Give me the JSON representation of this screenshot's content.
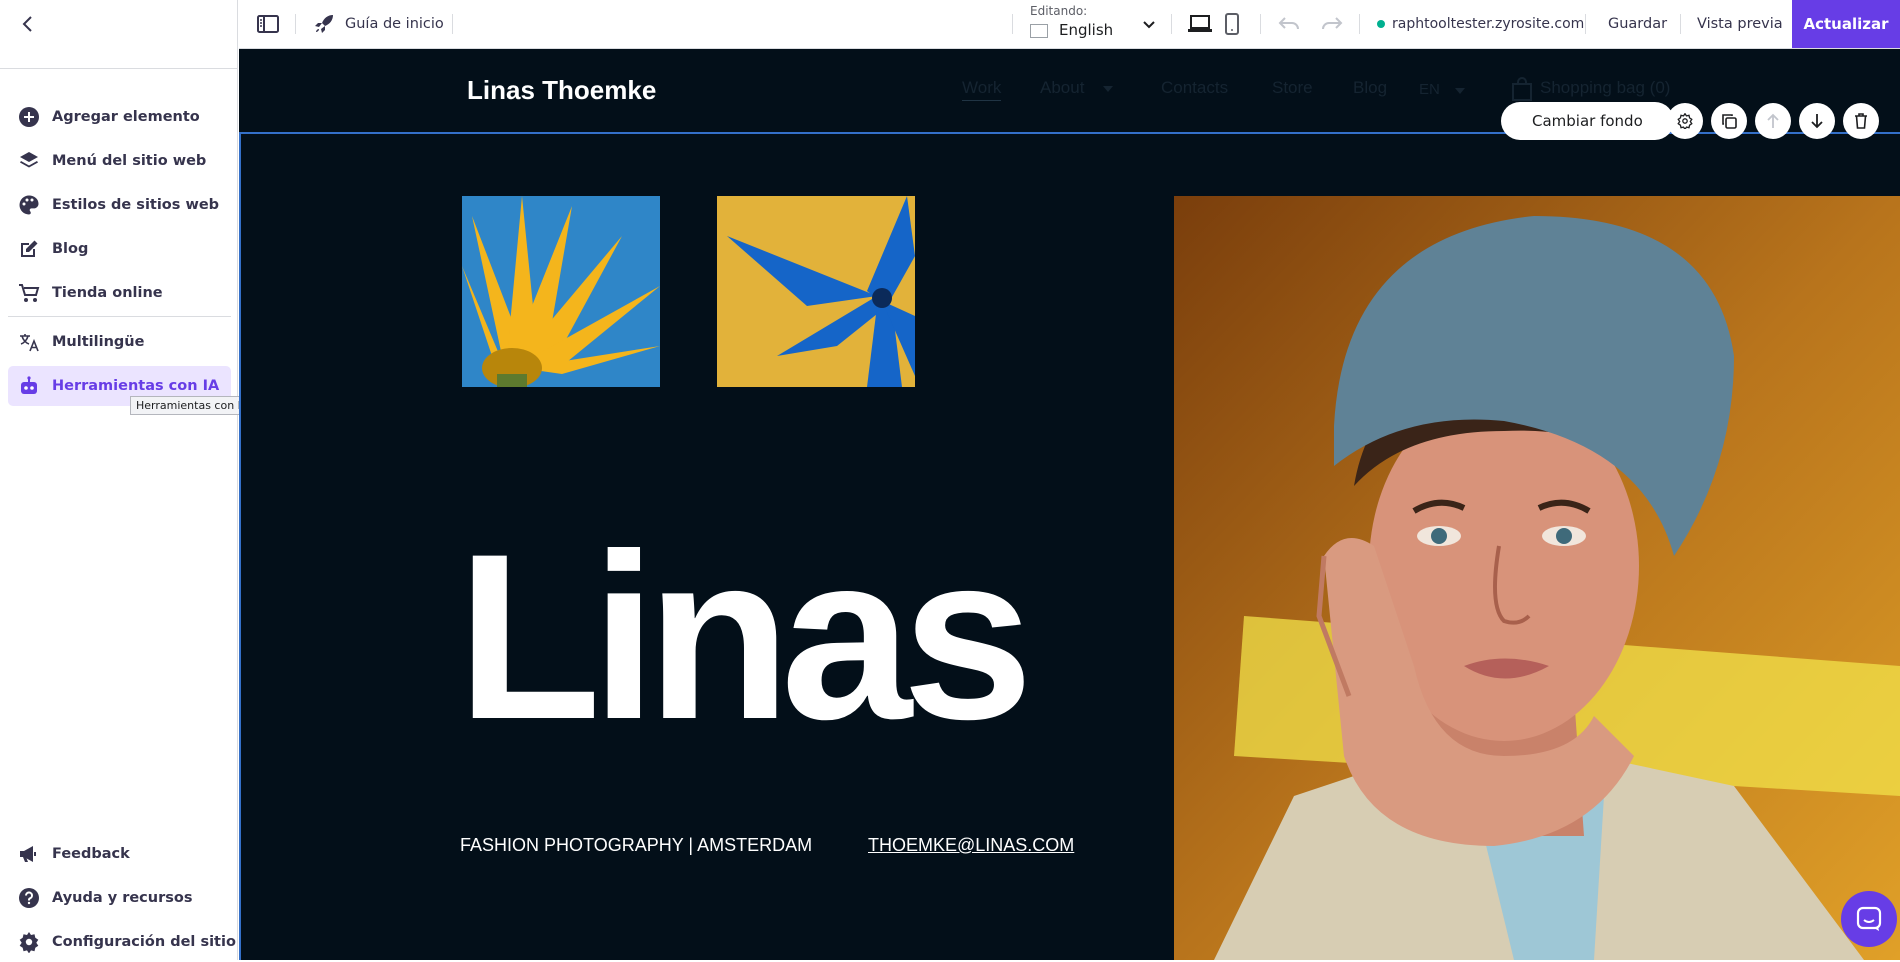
{
  "sidebar": {
    "items": [
      {
        "label": "Agregar elemento",
        "icon": "plus-circle-icon"
      },
      {
        "label": "Menú del sitio web",
        "icon": "layers-icon"
      },
      {
        "label": "Estilos de sitios web",
        "icon": "palette-icon"
      },
      {
        "label": "Blog",
        "icon": "edit-icon"
      },
      {
        "label": "Tienda online",
        "icon": "cart-icon"
      },
      {
        "label": "Multilingüe",
        "icon": "translate-icon"
      },
      {
        "label": "Herramientas con IA",
        "icon": "robot-icon",
        "active": true
      }
    ],
    "tooltip": "Herramientas con IA",
    "bottom_items": [
      {
        "label": "Feedback",
        "icon": "megaphone-icon"
      },
      {
        "label": "Ayuda y recursos",
        "icon": "help-icon"
      },
      {
        "label": "Configuración del sitio web",
        "icon": "gear-icon"
      }
    ]
  },
  "topbar": {
    "guide_label": "Guía de inicio",
    "editing_label": "Editando:",
    "language": "English",
    "url": "raphtooltester.zyrosite.com",
    "save_label": "Guardar",
    "preview_label": "Vista previa",
    "update_label": "Actualizar"
  },
  "site": {
    "title": "Linas Thoemke",
    "nav": [
      "Work",
      "About",
      "Contacts",
      "Store",
      "Blog",
      "EN",
      "Shopping bag (0)"
    ],
    "hero_name": "Linas",
    "tagline": "FASHION PHOTOGRAPHY | AMSTERDAM",
    "email": "THOEMKE@LINAS.COM"
  },
  "section_toolbar": {
    "change_bg_label": "Cambiar fondo"
  },
  "colors": {
    "accent": "#673de6",
    "canvas_bg": "#030f19",
    "selection_border": "#3470c9",
    "online_dot": "#00b090"
  }
}
